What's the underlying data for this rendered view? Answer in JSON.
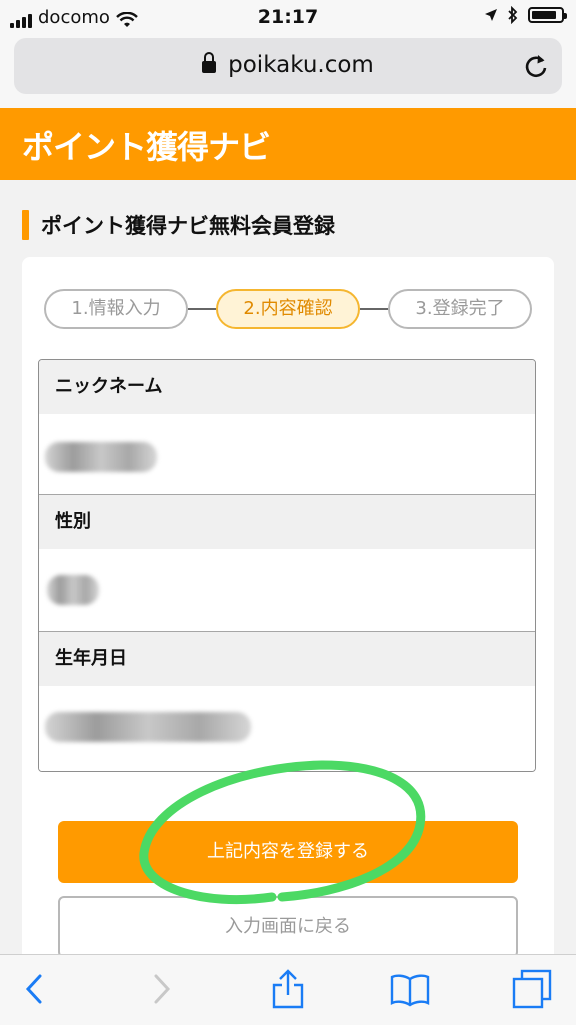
{
  "status_bar": {
    "carrier": "docomo",
    "time": "21:17",
    "signal_bars": 4
  },
  "browser": {
    "url": "poikaku.com"
  },
  "site": {
    "logo_text": "ポイント獲得ナビ",
    "brand_color": "#ff9a00"
  },
  "page": {
    "title": "ポイント獲得ナビ無料会員登録"
  },
  "steps": [
    {
      "label": "1.情報入力",
      "active": false
    },
    {
      "label": "2.内容確認",
      "active": true
    },
    {
      "label": "3.登録完了",
      "active": false
    }
  ],
  "fields": [
    {
      "label": "ニックネーム"
    },
    {
      "label": "性別"
    },
    {
      "label": "生年月日"
    }
  ],
  "actions": {
    "submit_label": "上記内容を登録する",
    "back_label": "入力画面に戻る"
  },
  "annotation_color": "#4cd964",
  "toolbar": {
    "icons": [
      "back-icon",
      "forward-icon",
      "share-icon",
      "bookmarks-icon",
      "tabs-icon"
    ]
  }
}
